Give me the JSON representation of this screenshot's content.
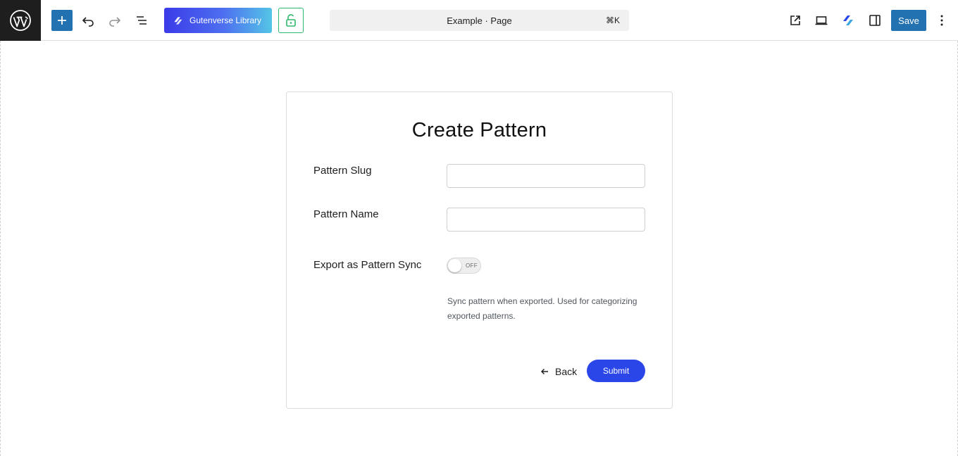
{
  "toolbar": {
    "library_label": "Gutenverse Library",
    "save_label": "Save"
  },
  "command_bar": {
    "title": "Example · Page",
    "shortcut": "⌘K"
  },
  "form": {
    "title": "Create Pattern",
    "slug_label": "Pattern Slug",
    "slug_value": "",
    "name_label": "Pattern Name",
    "name_value": "",
    "sync_label": "Export as Pattern Sync",
    "sync_toggle_text": "OFF",
    "sync_enabled": false,
    "help_text": "Sync pattern when exported. Used for categorizing exported patterns.",
    "back_label": "Back",
    "submit_label": "Submit"
  },
  "colors": {
    "wp_admin_blue": "#2271b1",
    "submit_blue": "#2a46e8",
    "lock_green": "#2eb86b"
  }
}
